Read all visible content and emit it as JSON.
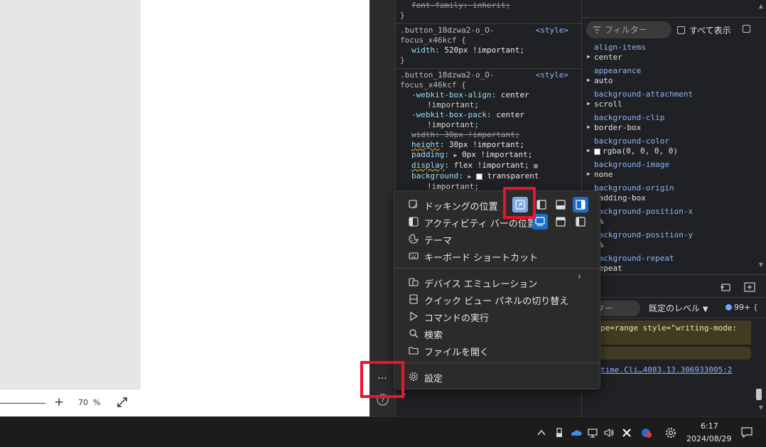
{
  "page": {
    "zoom_value": "70",
    "zoom_unit": "%"
  },
  "styles": {
    "rule0_decl": "font-family: inherit;",
    "rule1": {
      "selector_line1": ".button_18dzwa2-o_O-",
      "selector_line2": "focus_x46kcf {",
      "source": "<style>",
      "decl_prop": "width",
      "decl_val": "520px !important;"
    },
    "rule2": {
      "selector_line1": ".button_18dzwa2-o_O-",
      "selector_line2": "focus_x46kcf {",
      "source": "<style>",
      "d1_prop": "-webkit-box-align",
      "d1_val": "center",
      "d1_cont": "!important;",
      "d2_prop": "-webkit-box-pack",
      "d2_val": "center",
      "d2_cont": "!important;",
      "d3_strike": "width: 30px !important;",
      "d4_prop": "height",
      "d4_val": "30px !important;",
      "d5_prop": "padding",
      "d5_val": "0px !important;",
      "d6_prop": "display",
      "d6_val": "flex !important;",
      "d7_prop": "background",
      "d7_val": "transparent",
      "d7_cont": "!important;"
    },
    "close_brace": "}"
  },
  "computed": {
    "filter_placeholder": "フィルター",
    "show_all_label": "すべて表示",
    "properties": [
      {
        "name": "align-items",
        "value": "center"
      },
      {
        "name": "appearance",
        "value": "auto"
      },
      {
        "name": "background-attachment",
        "value": "scroll"
      },
      {
        "name": "background-clip",
        "value": "border-box"
      },
      {
        "name": "background-color",
        "value": "rgba(0, 0, 0, 0)"
      },
      {
        "name": "background-image",
        "value": "none"
      },
      {
        "name": "background-origin",
        "value": "padding-box"
      },
      {
        "name": "background-position-x",
        "value": "0%"
      },
      {
        "name": "background-position-y",
        "value": "0%"
      },
      {
        "name": "background-repeat",
        "value": "repeat"
      }
    ]
  },
  "console": {
    "filter_placeholder": "フィルター",
    "level_label": "既定のレベル",
    "issues_count": "99+",
    "warning_text": "pe=range style=\"writing-mode:",
    "link_text": "time.Cli…4083.13.306933005:2"
  },
  "menu": {
    "dock_label": "ドッキングの位置",
    "activity_label": "アクティビティ バーの位置",
    "theme_label": "テーマ",
    "shortcuts_label": "キーボード ショートカット",
    "device_emulation_label": "デバイス エミュレーション",
    "quick_view_label": "クイック ビュー パネルの切り替え",
    "run_command_label": "コマンドの実行",
    "search_label": "検索",
    "open_file_label": "ファイルを開く",
    "settings_label": "設定"
  },
  "taskbar": {
    "time": "6:17",
    "date": "2024/08/29"
  },
  "colors": {
    "highlight": "#e8152b",
    "accent": "#1a6fc8",
    "link": "#8ab4f8"
  }
}
